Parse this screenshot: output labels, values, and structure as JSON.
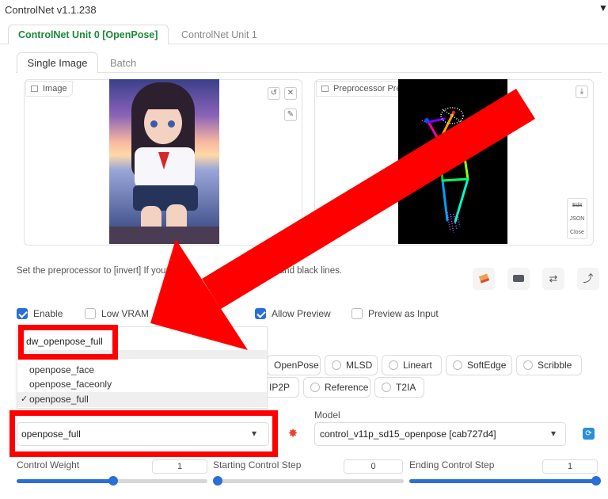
{
  "accordion": {
    "title": "ControlNet v1.1.238",
    "toggle_icon": "▼"
  },
  "unit_tabs": [
    {
      "label": "ControlNet Unit 0 [OpenPose]"
    },
    {
      "label": "ControlNet Unit 1"
    }
  ],
  "image_tabs": [
    {
      "label": "Single Image"
    },
    {
      "label": "Batch"
    }
  ],
  "image_panel": {
    "label": "Image",
    "icon": "image-icon"
  },
  "preview_panel": {
    "label": "Preprocessor Preview",
    "icon": "image-icon"
  },
  "pose_editor": {
    "edit": "Edit",
    "json": "JSON",
    "close": "Close"
  },
  "hint": {
    "text_start": "Set the preprocessor to [invert] If your ima",
    "text_end": "ound and black lines."
  },
  "checkboxes": {
    "enable": "Enable",
    "low_vram": "Low VRAM",
    "allow_preview": "Allow Preview",
    "preview_as_input": "Preview as Input"
  },
  "control_types": [
    "OpenPose",
    "MLSD",
    "Lineart",
    "SoftEdge",
    "Scribble",
    "IP2P",
    "Reference",
    "T2IA"
  ],
  "preprocessor": {
    "search_value": "dw_openpose_full",
    "options": [
      "openpose_face",
      "openpose_faceonly",
      "openpose_full"
    ],
    "selected_mark": "✓",
    "selected": "openpose_full",
    "caret": "▾"
  },
  "model": {
    "label": "Model",
    "selected": "control_v11p_sd15_openpose [cab727d4]",
    "caret": "▾"
  },
  "sliders": {
    "weight": {
      "label": "Control Weight",
      "value": "1",
      "fraction": 0.5
    },
    "start": {
      "label": "Starting Control Step",
      "value": "0",
      "fraction": 0
    },
    "end": {
      "label": "Ending Control Step",
      "value": "1",
      "fraction": 1
    }
  },
  "colors": {
    "accent": "#2b6fd6",
    "active_tab": "#1a8a3a",
    "highlight": "#ff0000"
  }
}
